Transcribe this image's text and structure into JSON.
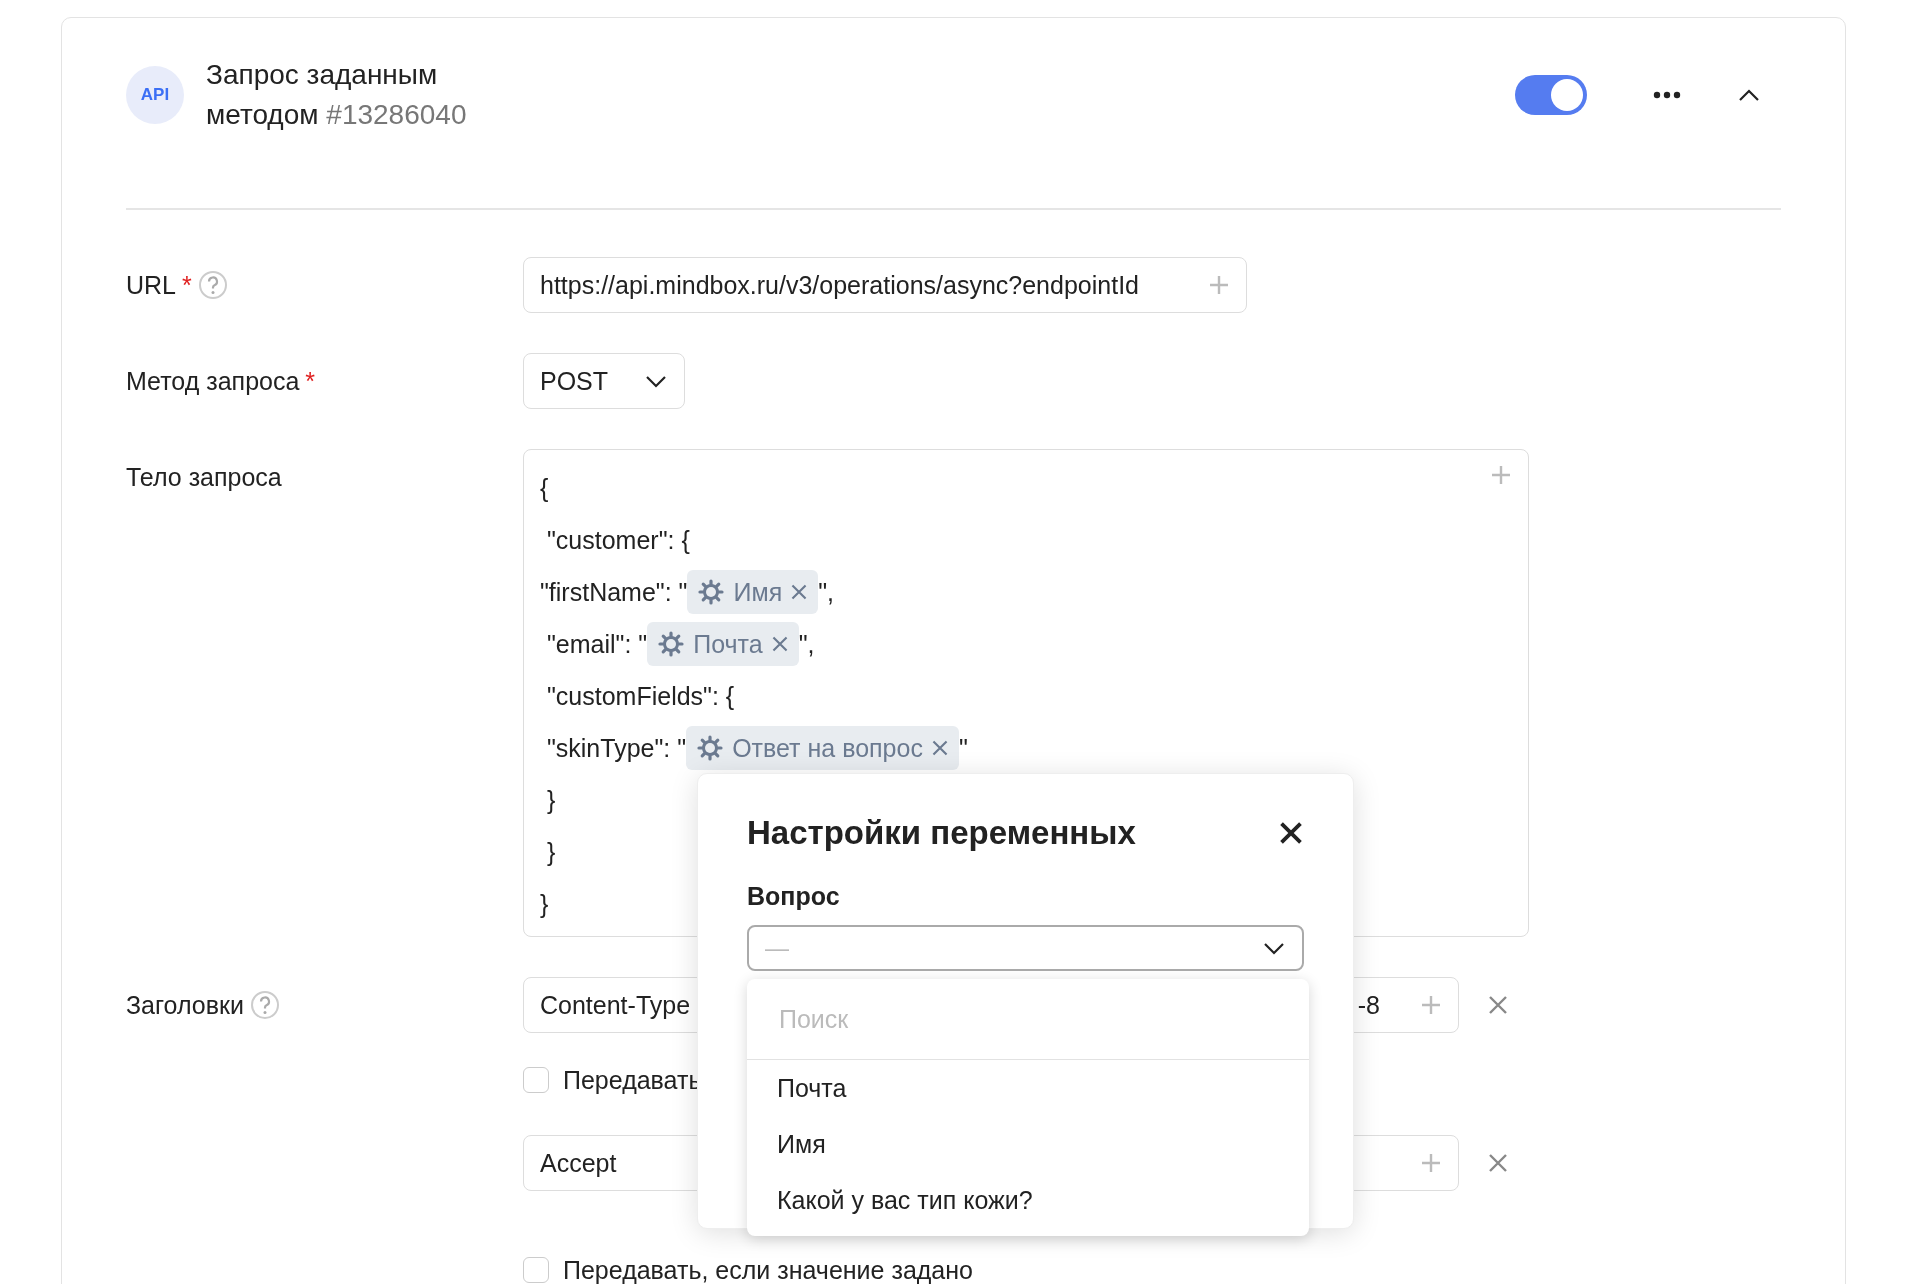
{
  "card": {
    "badge": "API",
    "title": "Запрос заданным методом",
    "id": "#13286040",
    "enabled": true
  },
  "fields": {
    "url_label": "URL",
    "url_required_mark": "*",
    "url_value": "https://api.mindbox.ru/v3/operations/async?endpointId",
    "method_label": "Метод запроса",
    "method_required_mark": "*",
    "method_value": "POST",
    "body_label": "Тело запроса",
    "body_lines": [
      {
        "parts": [
          {
            "kind": "text",
            "text": "{"
          }
        ]
      },
      {
        "parts": [
          {
            "kind": "text",
            "text": " \"customer\": {"
          }
        ]
      },
      {
        "parts": [
          {
            "kind": "text",
            "text": "\"firstName\": \""
          },
          {
            "kind": "chip",
            "text": "Имя"
          },
          {
            "kind": "text",
            "text": "\","
          }
        ]
      },
      {
        "parts": [
          {
            "kind": "text",
            "text": " \"email\": \""
          },
          {
            "kind": "chip",
            "text": "Почта"
          },
          {
            "kind": "text",
            "text": "\","
          }
        ]
      },
      {
        "parts": [
          {
            "kind": "text",
            "text": " \"customFields\": {"
          }
        ]
      },
      {
        "parts": [
          {
            "kind": "text",
            "text": " \"skinType\": \""
          },
          {
            "kind": "chip",
            "text": "Ответ на вопрос"
          },
          {
            "kind": "text",
            "text": "\""
          }
        ]
      },
      {
        "parts": [
          {
            "kind": "text",
            "text": " }"
          }
        ]
      },
      {
        "parts": [
          {
            "kind": "text",
            "text": " }"
          }
        ]
      },
      {
        "parts": [
          {
            "kind": "text",
            "text": "}"
          }
        ]
      }
    ],
    "headers_label": "Заголовки",
    "headers": [
      {
        "name": "Content-Type",
        "value": "-8",
        "checkbox_label": "Передавать",
        "checked": false
      },
      {
        "name": "Accept",
        "checkbox_label": "Передавать, если значение задано",
        "checked": false
      }
    ]
  },
  "modal": {
    "title": "Настройки переменных",
    "field_label": "Вопрос",
    "select_value": "—",
    "dropdown": {
      "placeholder": "Поиск",
      "options": [
        "Почта",
        "Имя",
        "Какой у вас тип кожи?"
      ]
    }
  }
}
